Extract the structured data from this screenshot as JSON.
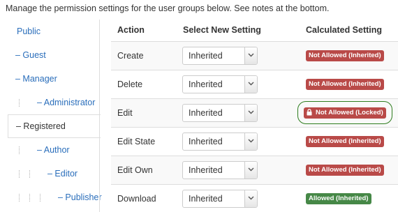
{
  "intro": "Manage the permission settings for the user groups below. See notes at the bottom.",
  "groups": [
    {
      "label": "Public",
      "depth": 0,
      "active": false
    },
    {
      "label": "– Guest",
      "depth": 1,
      "active": false
    },
    {
      "label": "– Manager",
      "depth": 1,
      "active": false
    },
    {
      "label": "– Administrator",
      "depth": 2,
      "active": false
    },
    {
      "label": "– Registered",
      "depth": 1,
      "active": true
    },
    {
      "label": "– Author",
      "depth": 2,
      "active": false
    },
    {
      "label": "– Editor",
      "depth": 3,
      "active": false
    },
    {
      "label": "– Publisher",
      "depth": 4,
      "active": false
    }
  ],
  "table": {
    "headers": {
      "action": "Action",
      "select": "Select New Setting",
      "calculated": "Calculated Setting"
    },
    "rows": [
      {
        "action": "Create",
        "setting": "Inherited",
        "calculated": "Not Allowed (Inherited)",
        "status": "red",
        "locked": false
      },
      {
        "action": "Delete",
        "setting": "Inherited",
        "calculated": "Not Allowed (Inherited)",
        "status": "red",
        "locked": false
      },
      {
        "action": "Edit",
        "setting": "Inherited",
        "calculated": "Not Allowed (Locked)",
        "status": "red",
        "locked": true
      },
      {
        "action": "Edit State",
        "setting": "Inherited",
        "calculated": "Not Allowed (Inherited)",
        "status": "red",
        "locked": false
      },
      {
        "action": "Edit Own",
        "setting": "Inherited",
        "calculated": "Not Allowed (Inherited)",
        "status": "red",
        "locked": false
      },
      {
        "action": "Download",
        "setting": "Inherited",
        "calculated": "Allowed (Inherited)",
        "status": "green",
        "locked": false
      }
    ]
  },
  "colors": {
    "link": "#2a6ebb",
    "not_allowed": "#b94a48",
    "allowed": "#468847",
    "highlight_ring": "#2e7d1e"
  }
}
